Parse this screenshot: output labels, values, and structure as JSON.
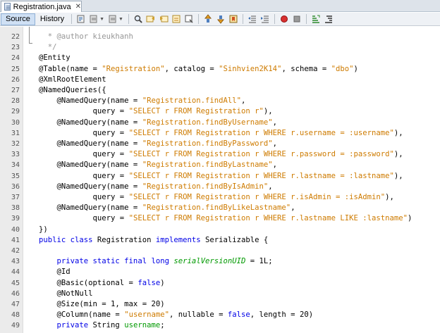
{
  "tab": {
    "label": "Registration.java",
    "icon": "java-file-icon"
  },
  "toolbar": {
    "source_label": "Source",
    "history_label": "History",
    "icons": [
      "last-edit-icon",
      "back-icon",
      "forward-icon",
      "find-icon",
      "find-previous-icon",
      "find-next-icon",
      "find-selection-icon",
      "toggle-highlight-icon",
      "previous-bookmark-icon",
      "next-bookmark-icon",
      "toggle-bookmark-icon",
      "shift-left-icon",
      "shift-right-icon",
      "start-macro-icon",
      "stop-macro-icon",
      "comment-icon",
      "uncomment-icon"
    ]
  },
  "colors": {
    "keyword": "#0000e6",
    "string": "#ce7b00",
    "comment": "#969696",
    "field": "#009900",
    "gutter": "#ebebeb"
  },
  "editor": {
    "lines": [
      {
        "n": "22",
        "parts": [
          {
            "t": "  * @author kieukhanh",
            "c": "com"
          }
        ]
      },
      {
        "n": "23",
        "parts": [
          {
            "t": "  */",
            "c": "com"
          }
        ]
      },
      {
        "n": "24",
        "parts": [
          {
            "t": "@Entity",
            "c": "ann"
          }
        ]
      },
      {
        "n": "25",
        "parts": [
          {
            "t": "@Table(name = ",
            "c": "ann"
          },
          {
            "t": "\"Registration\"",
            "c": "str"
          },
          {
            "t": ", catalog = ",
            "c": ""
          },
          {
            "t": "\"Sinhvien2K14\"",
            "c": "str"
          },
          {
            "t": ", schema = ",
            "c": ""
          },
          {
            "t": "\"dbo\"",
            "c": "str"
          },
          {
            "t": ")",
            "c": ""
          }
        ]
      },
      {
        "n": "26",
        "parts": [
          {
            "t": "@XmlRootElement",
            "c": "ann"
          }
        ]
      },
      {
        "n": "27",
        "parts": [
          {
            "t": "@NamedQueries({",
            "c": "ann"
          }
        ]
      },
      {
        "n": "28",
        "parts": [
          {
            "t": "    @NamedQuery(name = ",
            "c": "ann"
          },
          {
            "t": "\"Registration.findAll\"",
            "c": "str"
          },
          {
            "t": ",",
            "c": ""
          }
        ]
      },
      {
        "n": "29",
        "parts": [
          {
            "t": "            query = ",
            "c": ""
          },
          {
            "t": "\"SELECT r FROM Registration r\"",
            "c": "str"
          },
          {
            "t": "),",
            "c": ""
          }
        ]
      },
      {
        "n": "30",
        "parts": [
          {
            "t": "    @NamedQuery(name = ",
            "c": "ann"
          },
          {
            "t": "\"Registration.findByUsername\"",
            "c": "str"
          },
          {
            "t": ",",
            "c": ""
          }
        ]
      },
      {
        "n": "31",
        "parts": [
          {
            "t": "            query = ",
            "c": ""
          },
          {
            "t": "\"SELECT r FROM Registration r WHERE r.username = :username\"",
            "c": "str"
          },
          {
            "t": "),",
            "c": ""
          }
        ]
      },
      {
        "n": "32",
        "parts": [
          {
            "t": "    @NamedQuery(name = ",
            "c": "ann"
          },
          {
            "t": "\"Registration.findByPassword\"",
            "c": "str"
          },
          {
            "t": ",",
            "c": ""
          }
        ]
      },
      {
        "n": "33",
        "parts": [
          {
            "t": "            query = ",
            "c": ""
          },
          {
            "t": "\"SELECT r FROM Registration r WHERE r.password = :password\"",
            "c": "str"
          },
          {
            "t": "),",
            "c": ""
          }
        ]
      },
      {
        "n": "34",
        "parts": [
          {
            "t": "    @NamedQuery(name = ",
            "c": "ann"
          },
          {
            "t": "\"Registration.findByLastname\"",
            "c": "str"
          },
          {
            "t": ",",
            "c": ""
          }
        ]
      },
      {
        "n": "35",
        "parts": [
          {
            "t": "            query = ",
            "c": ""
          },
          {
            "t": "\"SELECT r FROM Registration r WHERE r.lastname = :lastname\"",
            "c": "str"
          },
          {
            "t": "),",
            "c": ""
          }
        ]
      },
      {
        "n": "36",
        "parts": [
          {
            "t": "    @NamedQuery(name = ",
            "c": "ann"
          },
          {
            "t": "\"Registration.findByIsAdmin\"",
            "c": "str"
          },
          {
            "t": ",",
            "c": ""
          }
        ]
      },
      {
        "n": "37",
        "parts": [
          {
            "t": "            query = ",
            "c": ""
          },
          {
            "t": "\"SELECT r FROM Registration r WHERE r.isAdmin = :isAdmin\"",
            "c": "str"
          },
          {
            "t": "),",
            "c": ""
          }
        ]
      },
      {
        "n": "38",
        "parts": [
          {
            "t": "    @NamedQuery(name = ",
            "c": "ann"
          },
          {
            "t": "\"Registration.findByLikeLastname\"",
            "c": "str"
          },
          {
            "t": ",",
            "c": ""
          }
        ]
      },
      {
        "n": "39",
        "parts": [
          {
            "t": "            query = ",
            "c": ""
          },
          {
            "t": "\"SELECT r FROM Registration r WHERE r.lastname LIKE :lastname\"",
            "c": "str"
          },
          {
            "t": ")",
            "c": ""
          }
        ]
      },
      {
        "n": "40",
        "parts": [
          {
            "t": "})",
            "c": ""
          }
        ]
      },
      {
        "n": "41",
        "parts": [
          {
            "t": "public class ",
            "c": "kw"
          },
          {
            "t": "Registration ",
            "c": ""
          },
          {
            "t": "implements ",
            "c": "kw"
          },
          {
            "t": "Serializable {",
            "c": ""
          }
        ]
      },
      {
        "n": "42",
        "parts": [
          {
            "t": "",
            "c": ""
          }
        ]
      },
      {
        "n": "43",
        "parts": [
          {
            "t": "    private static final long ",
            "c": "kw"
          },
          {
            "t": "serialVersionUID",
            "c": "fld"
          },
          {
            "t": " = 1L;",
            "c": ""
          }
        ]
      },
      {
        "n": "44",
        "parts": [
          {
            "t": "    @Id",
            "c": "ann"
          }
        ]
      },
      {
        "n": "45",
        "parts": [
          {
            "t": "    @Basic(optional = ",
            "c": "ann"
          },
          {
            "t": "false",
            "c": "kw"
          },
          {
            "t": ")",
            "c": ""
          }
        ]
      },
      {
        "n": "46",
        "parts": [
          {
            "t": "    @NotNull",
            "c": "ann"
          }
        ]
      },
      {
        "n": "47",
        "parts": [
          {
            "t": "    @Size(min = 1, max = 20)",
            "c": "ann"
          }
        ]
      },
      {
        "n": "48",
        "parts": [
          {
            "t": "    @Column(name = ",
            "c": "ann"
          },
          {
            "t": "\"username\"",
            "c": "str"
          },
          {
            "t": ", nullable = ",
            "c": ""
          },
          {
            "t": "false",
            "c": "kw"
          },
          {
            "t": ", length = 20)",
            "c": ""
          }
        ]
      },
      {
        "n": "49",
        "parts": [
          {
            "t": "    private ",
            "c": "kw"
          },
          {
            "t": "String ",
            "c": ""
          },
          {
            "t": "username",
            "c": "fldp"
          },
          {
            "t": ";",
            "c": ""
          }
        ]
      }
    ]
  }
}
